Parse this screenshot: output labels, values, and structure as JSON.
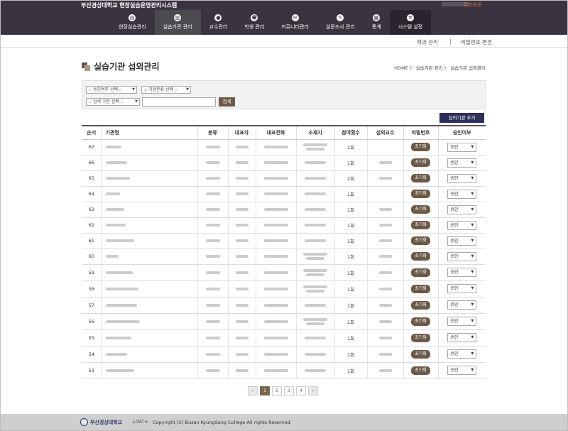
{
  "header": {
    "site_title": "부산경상대학교 현장실습운영관리시스템",
    "logout": "로그아웃",
    "nav": [
      {
        "label": "현장실습관리",
        "icon": "document-icon"
      },
      {
        "label": "실습기관 관리",
        "icon": "building-icon"
      },
      {
        "label": "교수관리",
        "icon": "person-icon"
      },
      {
        "label": "학생 관리",
        "icon": "people-icon"
      },
      {
        "label": "커뮤니티관리",
        "icon": "chat-icon"
      },
      {
        "label": "설문조사 관리",
        "icon": "survey-icon"
      },
      {
        "label": "통계",
        "icon": "chart-icon"
      },
      {
        "label": "시스템 설정",
        "icon": "gear-icon"
      }
    ]
  },
  "subnav": {
    "item1": "학과 관리",
    "separator": "|",
    "item2": "비밀번호 변경"
  },
  "page": {
    "title": "실습기관 섭외관리",
    "breadcrumb": "HOME 〉 실습기관 관리 〉 실습기관 섭외관리"
  },
  "search": {
    "approval_select": ":: 승인여부 선택 ::",
    "category_select": ":: 기업분류 선택 ::",
    "search_type_select": ":: 검색 구분 선택 ::",
    "search_button": "검색"
  },
  "add_button": "섭외기관 추가",
  "table": {
    "headers": [
      "순서",
      "기관명",
      "분류",
      "대표자",
      "대표전화",
      "소재지",
      "참여횟수",
      "섭외교수",
      "비밀번호",
      "승인여부"
    ],
    "reset_label": "초기화",
    "rows": [
      {
        "no": "67",
        "count": "1회"
      },
      {
        "no": "66",
        "count": "1회"
      },
      {
        "no": "65",
        "count": "2회"
      },
      {
        "no": "64",
        "count": "1회"
      },
      {
        "no": "63",
        "count": "1회"
      },
      {
        "no": "62",
        "count": "1회"
      },
      {
        "no": "61",
        "count": "1회"
      },
      {
        "no": "60",
        "count": "1회"
      },
      {
        "no": "59",
        "count": "1회"
      },
      {
        "no": "58",
        "count": "1회"
      },
      {
        "no": "57",
        "count": "1회"
      },
      {
        "no": "56",
        "count": "1회"
      },
      {
        "no": "55",
        "count": "1회"
      },
      {
        "no": "54",
        "count": "1회"
      },
      {
        "no": "53",
        "count": "1회"
      }
    ],
    "approval_value": "승인"
  },
  "pagination": {
    "prev": "«",
    "pages": [
      "1",
      "2",
      "3",
      "4"
    ],
    "next": "»",
    "current": "1"
  },
  "footer": {
    "school": "부산경상대학교",
    "linc": "LINC+",
    "copyright": "Copyright (C) Busan KyungSang College All rights Reserved."
  }
}
